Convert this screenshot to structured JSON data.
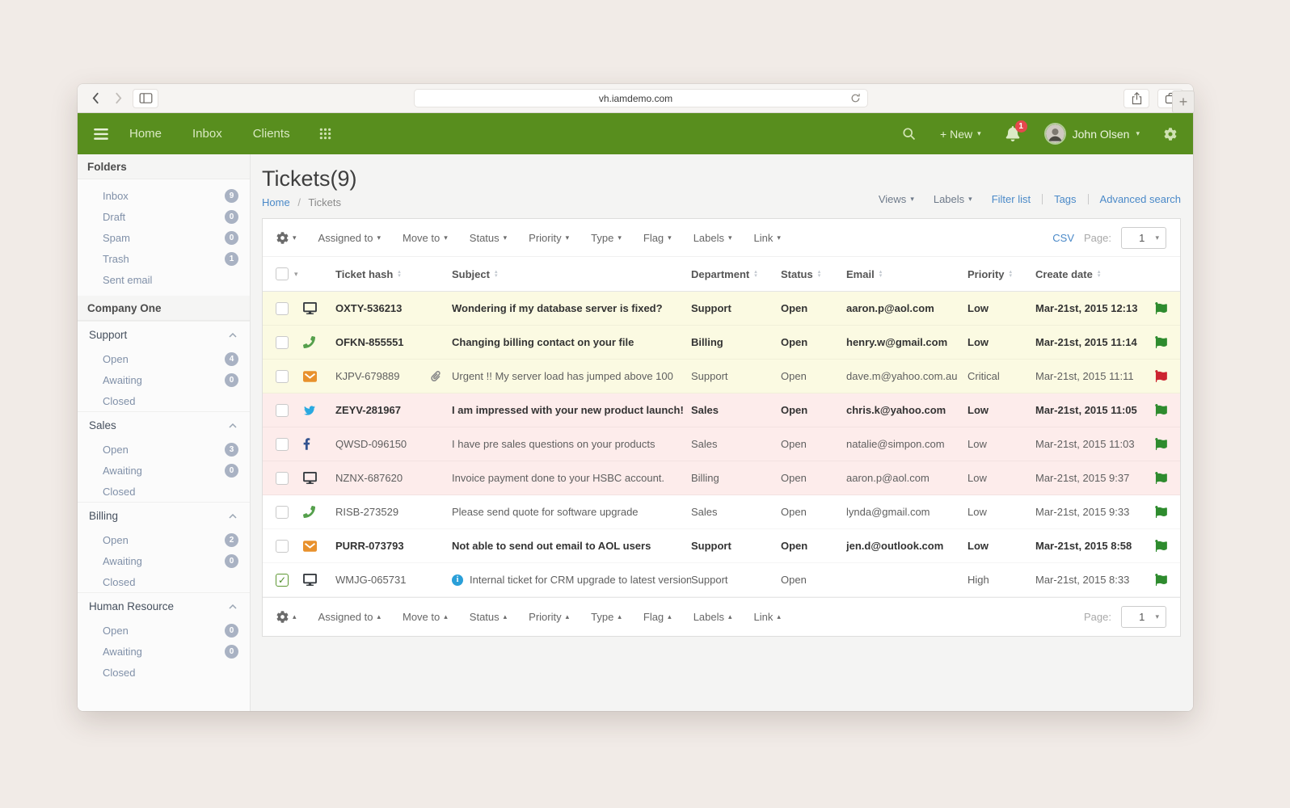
{
  "browser": {
    "url": "vh.iamdemo.com"
  },
  "navbar": {
    "items": [
      "Home",
      "Inbox",
      "Clients"
    ],
    "new_label": "+ New",
    "notification_count": "1",
    "user_name": "John Olsen"
  },
  "sidebar": {
    "folders_title": "Folders",
    "folders": [
      {
        "label": "Inbox",
        "count": "9"
      },
      {
        "label": "Draft",
        "count": "0"
      },
      {
        "label": "Spam",
        "count": "0"
      },
      {
        "label": "Trash",
        "count": "1"
      },
      {
        "label": "Sent email",
        "count": null
      }
    ],
    "company_title": "Company One",
    "sections": [
      {
        "label": "Support",
        "items": [
          {
            "label": "Open",
            "count": "4"
          },
          {
            "label": "Awaiting",
            "count": "0"
          },
          {
            "label": "Closed",
            "count": null
          }
        ]
      },
      {
        "label": "Sales",
        "items": [
          {
            "label": "Open",
            "count": "3"
          },
          {
            "label": "Awaiting",
            "count": "0"
          },
          {
            "label": "Closed",
            "count": null
          }
        ]
      },
      {
        "label": "Billing",
        "items": [
          {
            "label": "Open",
            "count": "2"
          },
          {
            "label": "Awaiting",
            "count": "0"
          },
          {
            "label": "Closed",
            "count": null
          }
        ]
      },
      {
        "label": "Human Resource",
        "items": [
          {
            "label": "Open",
            "count": "0"
          },
          {
            "label": "Awaiting",
            "count": "0"
          },
          {
            "label": "Closed",
            "count": null
          }
        ]
      }
    ]
  },
  "main": {
    "title": "Tickets(9)",
    "breadcrumb": [
      "Home",
      "Tickets"
    ],
    "breadcrumb_separator": "/",
    "header_links": {
      "views": "Views",
      "labels": "Labels",
      "filter_list": "Filter list",
      "tags": "Tags",
      "advanced_search": "Advanced search"
    },
    "toolbar": {
      "dropdowns": [
        "Assigned to",
        "Move to",
        "Status",
        "Priority",
        "Type",
        "Flag",
        "Labels",
        "Link"
      ],
      "csv_label": "CSV",
      "page_label": "Page:",
      "page_value": "1"
    },
    "table": {
      "columns": [
        "Ticket hash",
        "Subject",
        "Department",
        "Status",
        "Email",
        "Priority",
        "Create date"
      ],
      "rows": [
        {
          "channel": "desktop",
          "hash": "OXTY-536213",
          "attachment": false,
          "info": false,
          "subject": "Wondering if my database server is fixed?",
          "department": "Support",
          "status": "Open",
          "email": "aaron.p@aol.com",
          "priority": "Low",
          "created": "Mar-21st, 2015 12:13",
          "flag": "green",
          "unread": true,
          "tint": "yellow",
          "checked": false
        },
        {
          "channel": "phone",
          "hash": "OFKN-855551",
          "attachment": false,
          "info": false,
          "subject": "Changing billing contact on your file",
          "department": "Billing",
          "status": "Open",
          "email": "henry.w@gmail.com",
          "priority": "Low",
          "created": "Mar-21st, 2015 11:14",
          "flag": "green",
          "unread": true,
          "tint": "yellow",
          "checked": false
        },
        {
          "channel": "email",
          "hash": "KJPV-679889",
          "attachment": true,
          "info": false,
          "subject": "Urgent !! My server load has jumped above 100",
          "department": "Support",
          "status": "Open",
          "email": "dave.m@yahoo.com.au",
          "priority": "Critical",
          "created": "Mar-21st, 2015 11:11",
          "flag": "red",
          "unread": false,
          "tint": "yellow",
          "checked": false
        },
        {
          "channel": "twitter",
          "hash": "ZEYV-281967",
          "attachment": false,
          "info": false,
          "subject": "I am impressed with your new product launch!",
          "department": "Sales",
          "status": "Open",
          "email": "chris.k@yahoo.com",
          "priority": "Low",
          "created": "Mar-21st, 2015 11:05",
          "flag": "green",
          "unread": true,
          "tint": "pink",
          "checked": false
        },
        {
          "channel": "facebook",
          "hash": "QWSD-096150",
          "attachment": false,
          "info": false,
          "subject": "I have pre sales questions on your products",
          "department": "Sales",
          "status": "Open",
          "email": "natalie@simpon.com",
          "priority": "Low",
          "created": "Mar-21st, 2015 11:03",
          "flag": "green",
          "unread": false,
          "tint": "pink",
          "checked": false
        },
        {
          "channel": "desktop",
          "hash": "NZNX-687620",
          "attachment": false,
          "info": false,
          "subject": "Invoice payment done to your HSBC account.",
          "department": "Billing",
          "status": "Open",
          "email": "aaron.p@aol.com",
          "priority": "Low",
          "created": "Mar-21st, 2015 9:37",
          "flag": "green",
          "unread": false,
          "tint": "pink",
          "checked": false
        },
        {
          "channel": "phone",
          "hash": "RISB-273529",
          "attachment": false,
          "info": false,
          "subject": "Please send quote for software upgrade",
          "department": "Sales",
          "status": "Open",
          "email": "lynda@gmail.com",
          "priority": "Low",
          "created": "Mar-21st, 2015 9:33",
          "flag": "green",
          "unread": false,
          "tint": "white",
          "checked": false
        },
        {
          "channel": "email",
          "hash": "PURR-073793",
          "attachment": false,
          "info": false,
          "subject": "Not able to send out email to AOL users",
          "department": "Support",
          "status": "Open",
          "email": "jen.d@outlook.com",
          "priority": "Low",
          "created": "Mar-21st, 2015 8:58",
          "flag": "green",
          "unread": true,
          "tint": "white",
          "checked": false
        },
        {
          "channel": "desktop",
          "hash": "WMJG-065731",
          "attachment": false,
          "info": true,
          "subject": "Internal ticket for CRM upgrade to latest version",
          "department": "Support",
          "status": "Open",
          "email": "",
          "priority": "High",
          "created": "Mar-21st, 2015 8:33",
          "flag": "green",
          "unread": false,
          "tint": "white",
          "checked": true
        }
      ]
    }
  },
  "colors": {
    "accent_green": "#588e1e",
    "link_blue": "#4a89c8",
    "badge_gray": "#a9b2c3",
    "row_yellow": "#fbfae2",
    "row_pink": "#fdeceb",
    "flag_green": "#2e8b2e",
    "flag_red": "#cc2431",
    "notification_red": "#e5484d"
  }
}
